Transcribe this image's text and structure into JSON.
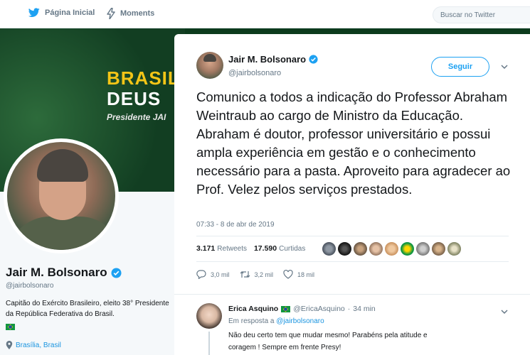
{
  "nav": {
    "home_label": "Página Inicial",
    "moments_label": "Moments",
    "search_placeholder": "Buscar no Twitter"
  },
  "banner": {
    "line1": "BRASIL",
    "line2": "DEUS",
    "line3": "Presidente JAI"
  },
  "profile": {
    "name": "Jair M. Bolsonaro",
    "handle": "@jairbolsonaro",
    "bio": "Capitão do Exército Brasileiro, eleito 38° Presidente da República Federativa do Brasil.",
    "location": "Brasília, Brasil"
  },
  "tweet": {
    "author_name": "Jair M. Bolsonaro",
    "author_handle": "@jairbolsonaro",
    "follow_label": "Seguir",
    "text": "Comunico a todos a indicação do Professor Abraham Weintraub ao cargo de Ministro da Educação. Abraham é doutor, professor universitário e possui ampla experiência em gestão e o conhecimento necessário para a pasta. Aproveito para agradecer ao Prof. Velez pelos serviços prestados.",
    "timestamp": "07:33 - 8 de abr de 2019",
    "retweets_count": "3.171",
    "retweets_label": "Retweets",
    "likes_count": "17.590",
    "likes_label": "Curtidas",
    "reply_count": "3,0 mil",
    "retweet_action_count": "3,2 mil",
    "like_action_count": "18 mil"
  },
  "reply": {
    "name": "Erica Asquino",
    "handle": "@EricaAsquino",
    "separator": "·",
    "time": "34 min",
    "in_reply_prefix": "Em resposta a",
    "in_reply_handle": "@jairbolsonaro",
    "text": "Não deu certo tem que mudar mesmo! Parabéns pela atitude e coragem ! Sempre em frente Presy!"
  },
  "colors": {
    "accent": "#1da1f2",
    "verified": "#1da1f2",
    "banner_green": "#124b26",
    "banner_yellow": "#f3c517",
    "heart": "#e0245e"
  }
}
